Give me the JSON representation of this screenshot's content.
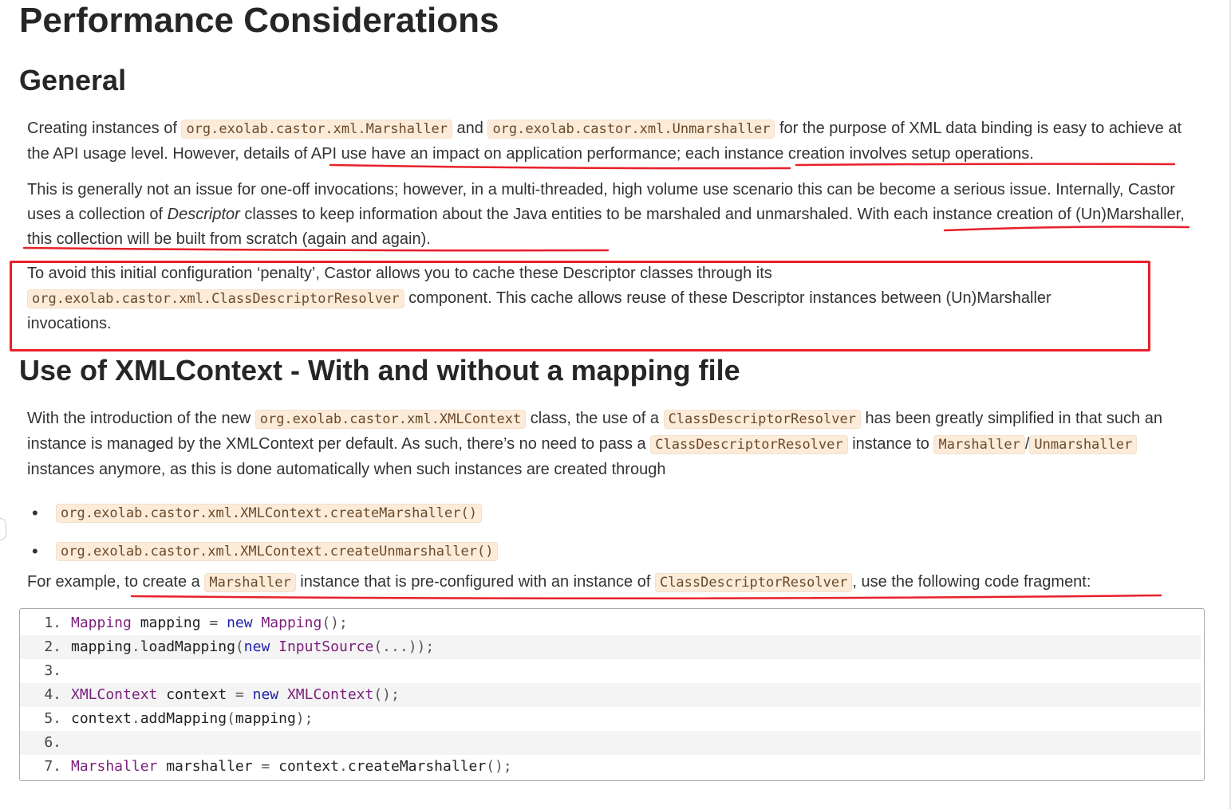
{
  "title": "Performance Considerations",
  "general": {
    "heading": "General",
    "p1": {
      "t1": "Creating instances of ",
      "c1": "org.exolab.castor.xml.Marshaller",
      "t2": " and ",
      "c2": "org.exolab.castor.xml.Unmarshaller",
      "t3": " for the purpose of XML data binding is easy to achieve at the API usage level. However, details of API use have an impact on application performance; each instance creation involves setup operations."
    },
    "p2": {
      "t1": "This is generally not an issue for one-off invocations; however, in a multi-threaded, high volume use scenario this can be become a serious issue. Internally, Castor uses a collection of ",
      "em": "Descriptor",
      "t2": " classes to keep information about the Java entities to be marshaled and unmarshaled. With each instance creation of (Un)Marshaller, this collection will be built from scratch (again and again)."
    },
    "p3": {
      "t1": "To avoid this initial configuration ‘penalty’, Castor allows you to cache these Descriptor classes through its",
      "c1": "org.exolab.castor.xml.ClassDescriptorResolver",
      "t2": " component. This cache allows reuse of these Descriptor instances between (Un)Marshaller invocations."
    }
  },
  "xmlcontext": {
    "heading": "Use of XMLContext - With and without a mapping file",
    "p1": {
      "t1": "With the introduction of the new ",
      "c1": "org.exolab.castor.xml.XMLContext",
      "t2": " class, the use of a ",
      "c2": "ClassDescriptorResolver",
      "t3": " has been greatly simplified in that such an instance is managed by the XMLContext per default. As such, there’s no need to pass a ",
      "c3": "ClassDescriptorResolver",
      "t4": " instance to ",
      "c4": "Marshaller",
      "t5": "/",
      "c5": "Unmarshaller",
      "t6": " instances anymore, as this is done automatically when such instances are created through"
    },
    "bullets": [
      "org.exolab.castor.xml.XMLContext.createMarshaller()",
      "org.exolab.castor.xml.XMLContext.createUnmarshaller()"
    ],
    "p2": {
      "t1": "For example, to create a ",
      "c1": "Marshaller",
      "t2": " instance that is pre-configured with an instance of ",
      "c2": "ClassDescriptorResolver",
      "t3": ", use the following code fragment:"
    },
    "code": [
      {
        "num": "1.",
        "parts": [
          [
            "ty",
            "Mapping"
          ],
          [
            "",
            ""
          ],
          [
            "pl",
            " mapping "
          ],
          [
            "pn",
            "="
          ],
          [
            "pl",
            " "
          ],
          [
            "kw",
            "new"
          ],
          [
            "pl",
            " "
          ],
          [
            "ty",
            "Mapping"
          ],
          [
            "pn",
            "();"
          ]
        ]
      },
      {
        "num": "2.",
        "parts": [
          [
            "pl",
            "mapping"
          ],
          [
            "pn",
            "."
          ],
          [
            "pl",
            "loadMapping"
          ],
          [
            "pn",
            "("
          ],
          [
            "kw",
            "new"
          ],
          [
            "pl",
            " "
          ],
          [
            "ty",
            "InputSource"
          ],
          [
            "pn",
            "(...));"
          ]
        ]
      },
      {
        "num": "3.",
        "parts": []
      },
      {
        "num": "4.",
        "parts": [
          [
            "ty",
            "XMLContext"
          ],
          [
            "pl",
            " context "
          ],
          [
            "pn",
            "="
          ],
          [
            "pl",
            " "
          ],
          [
            "kw",
            "new"
          ],
          [
            "pl",
            " "
          ],
          [
            "ty",
            "XMLContext"
          ],
          [
            "pn",
            "();"
          ]
        ]
      },
      {
        "num": "5.",
        "parts": [
          [
            "pl",
            "context"
          ],
          [
            "pn",
            "."
          ],
          [
            "pl",
            "addMapping"
          ],
          [
            "pn",
            "("
          ],
          [
            "pl",
            "mapping"
          ],
          [
            "pn",
            ");"
          ]
        ]
      },
      {
        "num": "6.",
        "parts": []
      },
      {
        "num": "7.",
        "parts": [
          [
            "ty",
            "Marshaller"
          ],
          [
            "pl",
            " marshaller "
          ],
          [
            "pn",
            "="
          ],
          [
            "pl",
            " context"
          ],
          [
            "pn",
            "."
          ],
          [
            "pl",
            "createMarshaller"
          ],
          [
            "pn",
            "();"
          ]
        ]
      }
    ]
  },
  "colors": {
    "annotation": "#e8202a",
    "code_bg": "#fcebd9",
    "code_fg": "#6b4a2b"
  }
}
